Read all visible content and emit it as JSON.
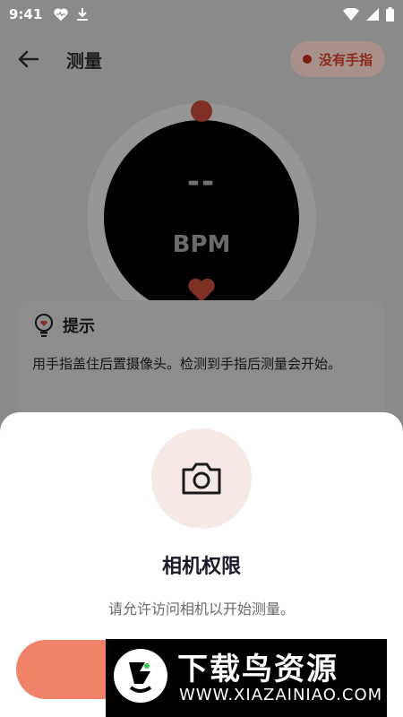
{
  "status_bar": {
    "time": "9:41"
  },
  "header": {
    "title": "测量",
    "finger_status": "没有手指"
  },
  "measure": {
    "reading": "--",
    "unit": "BPM"
  },
  "tip": {
    "title": "提示",
    "text": "用手指盖住后置摄像头。检测到手指后测量会开始。"
  },
  "permission_sheet": {
    "title": "相机权限",
    "description": "请允许访问相机以开始测量。"
  },
  "watermark": {
    "brand": "下载鸟资源",
    "url": "WWW.XIAZAINIAO.COM"
  },
  "colors": {
    "accent": "#f0826a",
    "icon_bg": "#f6e8e5"
  }
}
